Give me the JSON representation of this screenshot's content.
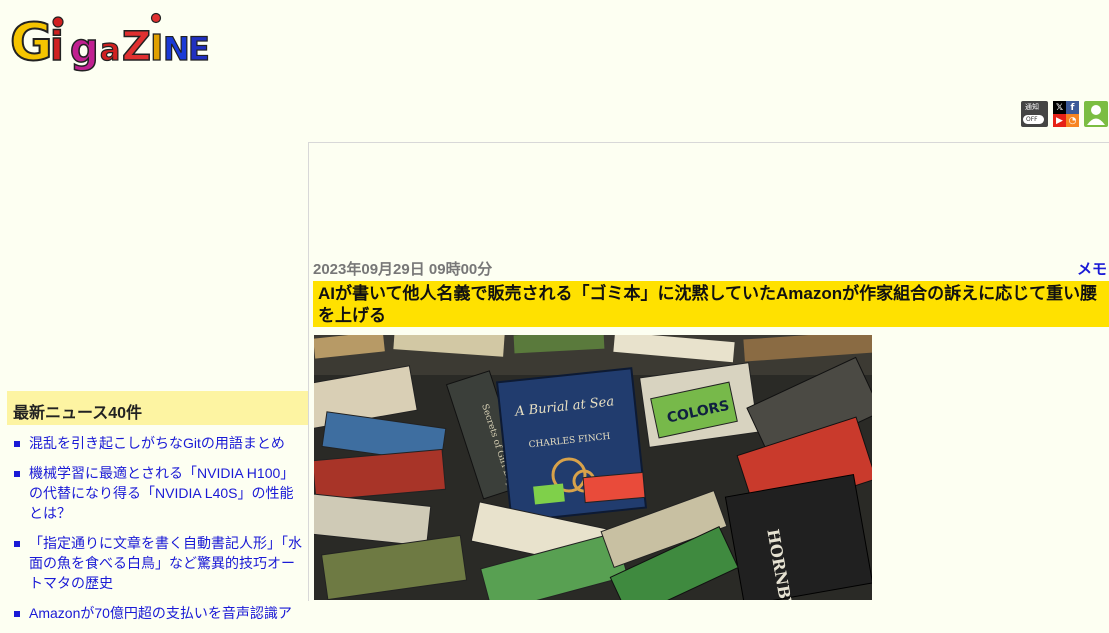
{
  "site": {
    "logo_text": "GigaZINE"
  },
  "header": {
    "notify_label": "通知",
    "notify_state": "OFF",
    "social_icons": [
      "x-icon",
      "facebook-icon",
      "youtube-icon",
      "rss-icon"
    ],
    "user_icon": "user-icon"
  },
  "article": {
    "date": "2023年09月29日 09時00分",
    "memo_label": "メモ",
    "title": "AIが書いて他人名義で販売される「ゴミ本」に沈黙していたAmazonが作家組合の訴えに応じて重い腰を上げる",
    "image_book_titles": [
      "A Burial at Sea",
      "CHARLES FINCH",
      "COLORS",
      "Secrets of Girl Days",
      "HORNBY"
    ]
  },
  "sidebar": {
    "heading": "最新ニュース40件",
    "news": [
      "混乱を引き起こしがちなGitの用語まとめ",
      "機械学習に最適とされる「NVIDIA H100」の代替になり得る「NVIDIA L40S」の性能とは？",
      "「指定通りに文章を書く自動書記人形」「水面の魚を食べる白鳥」など驚異的技巧オートマタの歴史",
      "Amazonが70億円超の支払いを音声認識ア"
    ]
  },
  "colors": {
    "page_bg": "#fdfff2",
    "title_bg": "#ffe100",
    "sidebar_header_bg": "#fdf4a2",
    "link": "#1a1ad6"
  }
}
